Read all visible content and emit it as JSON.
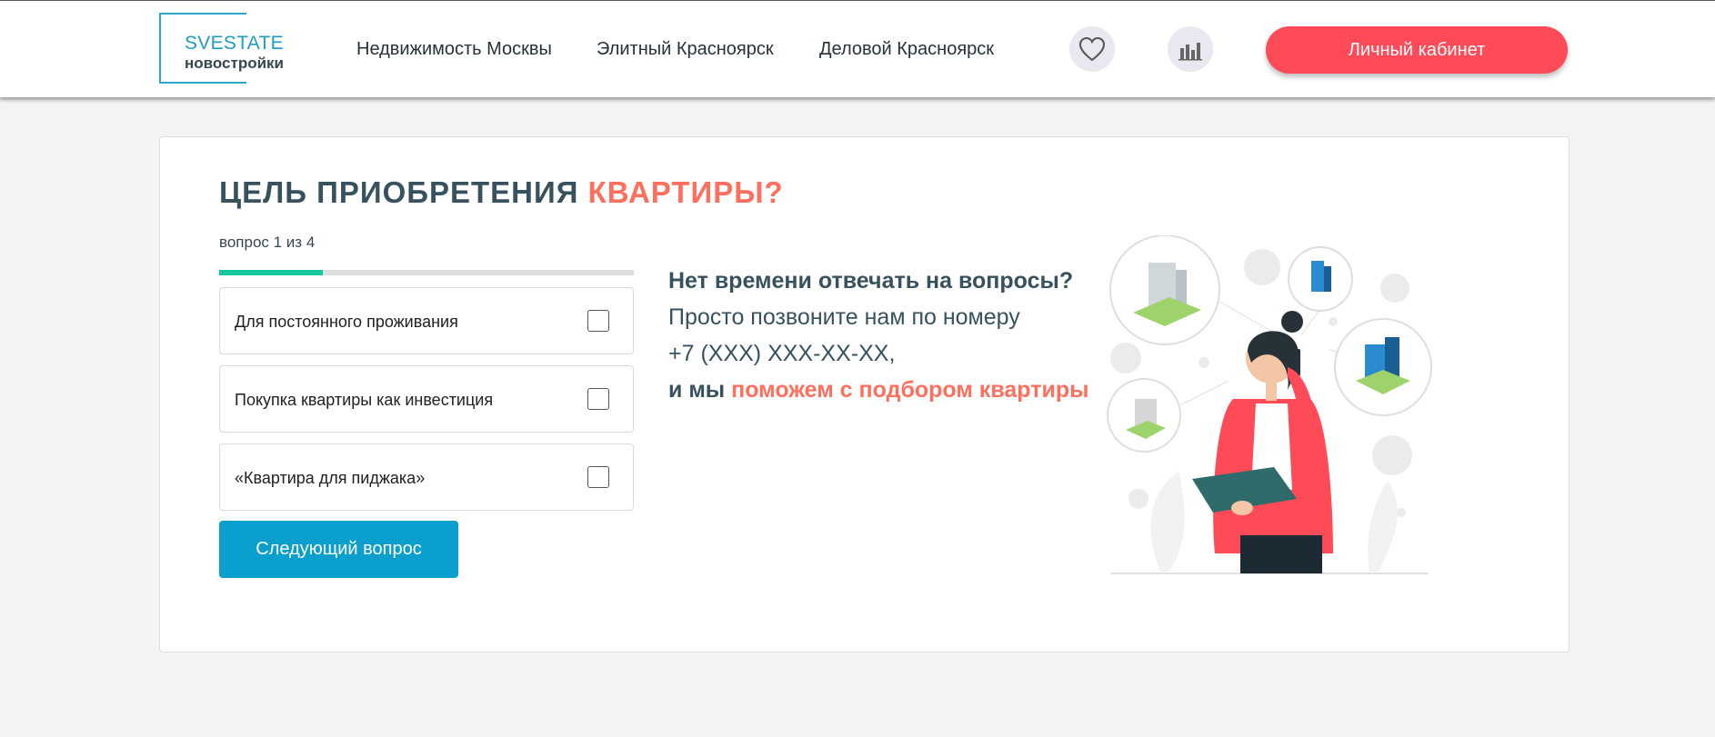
{
  "header": {
    "logo": {
      "line1": "SVESTATE",
      "line2": "новостройки"
    },
    "nav": [
      {
        "label": "Недвижимость Москвы"
      },
      {
        "label": "Элитный Красноярск"
      },
      {
        "label": "Деловой Красноярск"
      }
    ],
    "icons": {
      "favorites": "heart-icon",
      "compare": "bar-chart-icon"
    },
    "cabinet_label": "Личный кабинет"
  },
  "quiz": {
    "title_main": "ЦЕЛЬ ПРИОБРЕТЕНИЯ",
    "title_accent": "КВАРТИРЫ?",
    "progress_label": "вопрос 1 из 4",
    "progress_fraction": 0.25,
    "options": [
      {
        "label": "Для постоянного проживания",
        "checked": false
      },
      {
        "label": "Покупка квартиры как инвестиция",
        "checked": false
      },
      {
        "label": "«Квартира для пиджака»",
        "checked": false
      }
    ],
    "next_label": "Следующий вопрос"
  },
  "info": {
    "line1": "Нет времени отвечать на вопросы?",
    "line2": "Просто позвоните нам по номеру",
    "line3": "+7 (XXX) XXX-XX-XX,",
    "line4_start": "и мы",
    "line4_accent": "поможем с подбором квартиры"
  },
  "colors": {
    "accent": "#ff6f5e",
    "cabinet_button": "#ff4a57",
    "next_button": "#0a9fcc",
    "progress": "#17c7a0",
    "brand": "#1e9cc4"
  }
}
